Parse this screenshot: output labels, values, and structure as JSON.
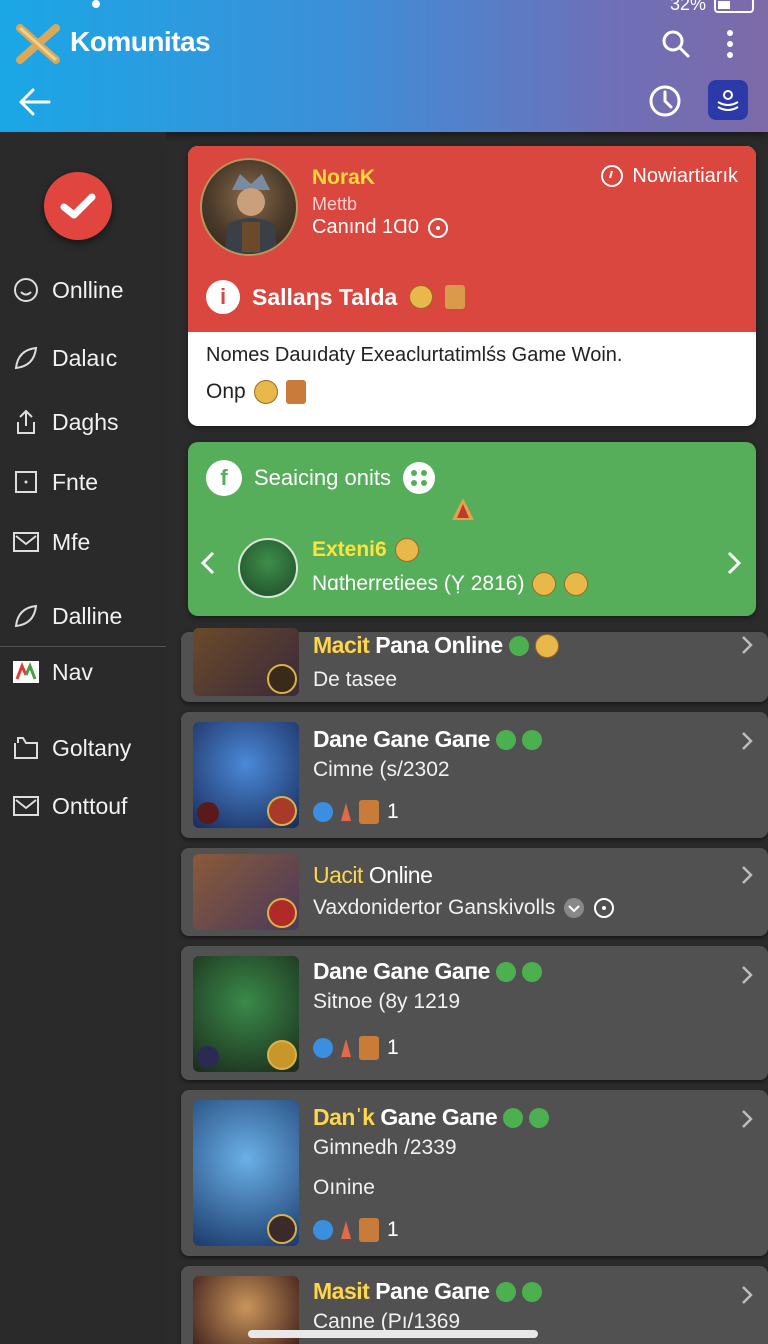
{
  "status": {
    "battery": "32%"
  },
  "header": {
    "title": "Komunitas",
    "icons": [
      "app-logo-icon",
      "search-icon",
      "more-vert-icon",
      "back-arrow-icon",
      "clock-icon",
      "badge-icon"
    ]
  },
  "sidebar": {
    "items": [
      {
        "label": "Onlline",
        "icon": "smiley-icon"
      },
      {
        "label": "Dalaıc",
        "icon": "leaf-icon"
      },
      {
        "label": "Daghs",
        "icon": "share-icon"
      },
      {
        "label": "Fnte",
        "icon": "square-icon"
      },
      {
        "label": "Mfe",
        "icon": "mail-icon"
      },
      {
        "label": "Dalline",
        "icon": "leaf-icon"
      },
      {
        "label": "Nav",
        "icon": "chart-icon"
      },
      {
        "label": "Goltany",
        "icon": "folder-icon"
      },
      {
        "label": "Onttouf",
        "icon": "mail-icon"
      }
    ]
  },
  "featured": {
    "name": "NoraK",
    "sub": "Mettb",
    "count": "Canınd 1Ɑ0",
    "status": "Nowiartiarık",
    "banner": "Sallaηs Talda",
    "desc": "Nomes Dauıdaty Exeaclurtatimlśs Game Woin.",
    "extra": "Onp"
  },
  "green_card": {
    "title": "Seaicing onits",
    "name": "Exteni6",
    "sub": "Nɑtherretiees (Ỵ 2816)"
  },
  "rows": [
    {
      "title_accent": "Macit",
      "title_rest": "Pana Online",
      "sub": "De tasee",
      "meta": ""
    },
    {
      "title_accent": "",
      "title_rest": "Dane Gane Gaпe",
      "sub": "Cimne (s/2302",
      "meta": "1"
    },
    {
      "title_accent": "Uacit",
      "title_rest": "Online",
      "sub": "Vaxdonidertor Ganskivolls",
      "meta": ""
    },
    {
      "title_accent": "",
      "title_rest": "Dane Gane Gaпe",
      "sub": "Sitnoe (8y 1219",
      "meta": "1"
    },
    {
      "title_accent": "Danˈk",
      "title_rest": "Gane Gaпe",
      "sub": "Gimnedh /2339",
      "sub2": "Oınine",
      "meta": "1"
    },
    {
      "title_accent": "Masit",
      "title_rest": "Pane Gaпe",
      "sub": "Canne (Pı/1369",
      "meta": ""
    }
  ],
  "colors": {
    "header_start": "#1aa7e6",
    "header_end": "#7d6aa8",
    "featured_red": "#d9473f",
    "green": "#56ae5b",
    "accent_yellow": "#ffd54a"
  }
}
